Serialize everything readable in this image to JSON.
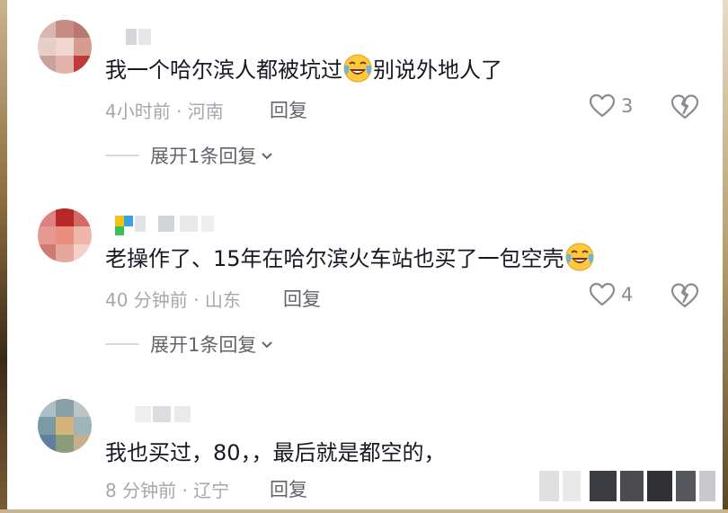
{
  "comments": [
    {
      "text_before": "我一个哈尔滨人都被坑过",
      "text_after": "别说外地人了",
      "meta": "4小时前 · 河南",
      "reply": "回复",
      "likes": "3",
      "expand": "展开1条回复",
      "emoji": "laughing-crying"
    },
    {
      "text_before": "老操作了、15年在哈尔滨火车站也买了一包空壳",
      "text_after": "",
      "meta": "40 分钟前 · 山东",
      "reply": "回复",
      "likes": "4",
      "expand": "展开1条回复",
      "emoji": "laughing-crying"
    },
    {
      "text_before": "我也买过，80，，最后就是都空的，",
      "text_after": "",
      "meta": "8 分钟前 · 辽宁",
      "reply": "回复",
      "likes": "",
      "expand": "",
      "emoji": ""
    }
  ],
  "colors": {
    "text": "#161823",
    "meta": "#a5a7ad",
    "reply": "#62646b"
  }
}
